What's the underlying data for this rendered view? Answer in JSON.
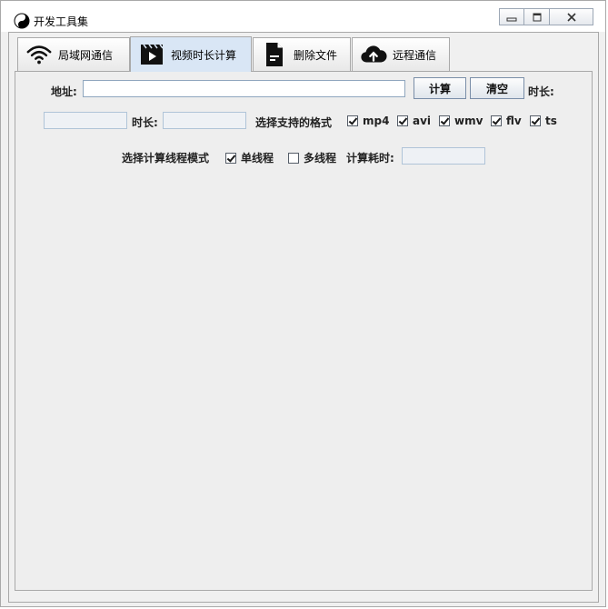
{
  "window": {
    "title": "开发工具集",
    "minimize_label": "minimize",
    "maximize_label": "maximize",
    "close_label": "close"
  },
  "tabs": [
    {
      "label": "局域网通信",
      "icon": "wifi-icon",
      "active": false
    },
    {
      "label": "视频时长计算",
      "icon": "video-icon",
      "active": true
    },
    {
      "label": "删除文件",
      "icon": "document-icon",
      "active": false
    },
    {
      "label": "远程通信",
      "icon": "cloud-upload-icon",
      "active": false
    }
  ],
  "form": {
    "address_label": "地址:",
    "address_value": "",
    "calc_button": "计算",
    "clear_button": "清空",
    "duration_label_right": "时长:",
    "result_value": "",
    "duration_label": "时长:",
    "duration_value": "",
    "formats_label": "选择支持的格式",
    "formats": [
      {
        "label": "mp4",
        "checked": true
      },
      {
        "label": "avi",
        "checked": true
      },
      {
        "label": "wmv",
        "checked": true
      },
      {
        "label": "flv",
        "checked": true
      },
      {
        "label": "ts",
        "checked": true
      }
    ],
    "thread_mode_label": "选择计算线程模式",
    "single_thread_label": "单线程",
    "single_thread_checked": true,
    "multi_thread_label": "多线程",
    "multi_thread_checked": false,
    "elapsed_label": "计算耗时:",
    "elapsed_value": ""
  }
}
